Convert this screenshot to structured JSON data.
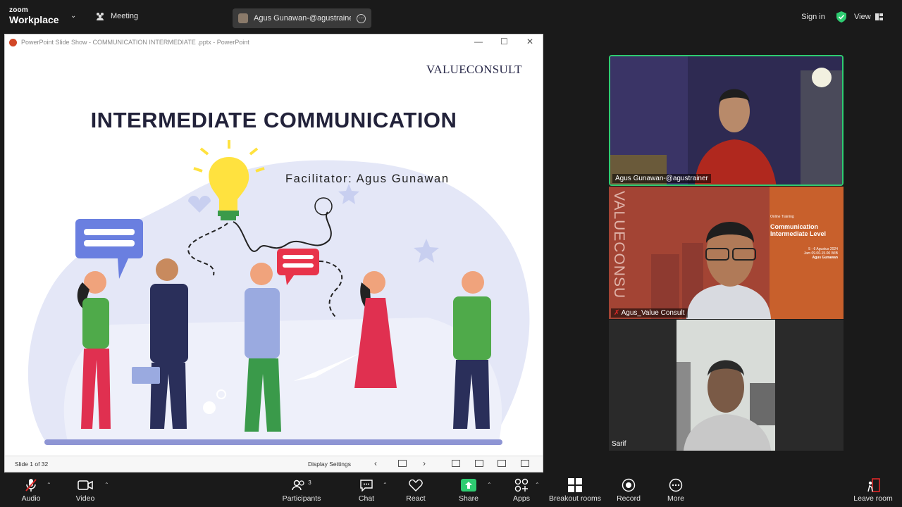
{
  "topbar": {
    "logo_line1": "zoom",
    "logo_line2": "Workplace",
    "meeting_label": "Meeting",
    "share_label": "Agus Gunawan-@agustrainer's sc",
    "signin_label": "Sign in",
    "view_label": "View"
  },
  "ppt": {
    "window_title": "PowerPoint Slide Show  -  COMMUNICATION INTERMEDIATE .pptx - PowerPoint",
    "slide_title": "INTERMEDIATE COMMUNICATION",
    "facilitator": "Facilitator: Agus Gunawan",
    "logo_part1": "VALUE",
    "logo_part2": "CONSULT",
    "slide_counter": "Slide 1 of 32",
    "display_settings": "Display Settings"
  },
  "tiles": {
    "t1_name": "Agus Gunawan-@agustrainer",
    "t2_name": "Agus_Value Consult",
    "t2_bg_vertical": "VALUECONSU",
    "t2_card_line1": "Communication",
    "t2_card_line2": "Intermediate Level",
    "t2_card_small1": "Online Training",
    "t2_card_date": "5 - 6 Agustus 2024",
    "t2_card_time": "Jam 09.00-15.00 WIB",
    "t2_card_person": "Agus Gunawan",
    "t3_name": "Sarif"
  },
  "toolbar": {
    "audio": "Audio",
    "video": "Video",
    "participants": "Participants",
    "participants_count": "3",
    "chat": "Chat",
    "react": "React",
    "share": "Share",
    "apps": "Apps",
    "breakout": "Breakout rooms",
    "record": "Record",
    "more": "More",
    "leave": "Leave room"
  },
  "colors": {
    "active_speaker": "#2ecc71",
    "share_green": "#2ecc71",
    "mute_red": "#e02828"
  }
}
